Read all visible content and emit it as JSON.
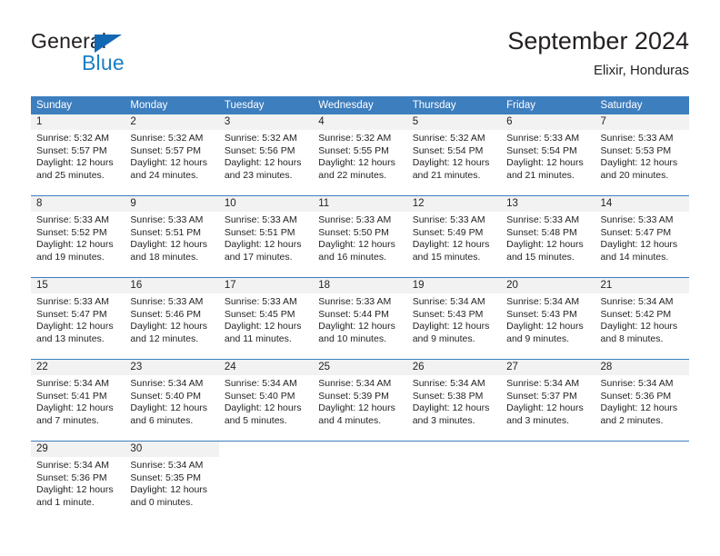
{
  "brand": {
    "name_part1": "General",
    "name_part2": "Blue",
    "triangle_icon": "triangle-icon",
    "color_dark": "#231f20",
    "color_blue": "#1b7fc4"
  },
  "header": {
    "title": "September 2024",
    "subtitle": "Elixir, Honduras"
  },
  "calendar": {
    "accent_color": "#3d7ebf",
    "daynum_band_color": "#f2f2f2",
    "weekday_headers": [
      "Sunday",
      "Monday",
      "Tuesday",
      "Wednesday",
      "Thursday",
      "Friday",
      "Saturday"
    ],
    "weeks": [
      [
        {
          "day": "1",
          "sunrise": "Sunrise: 5:32 AM",
          "sunset": "Sunset: 5:57 PM",
          "daylight_line1": "Daylight: 12 hours",
          "daylight_line2": "and 25 minutes."
        },
        {
          "day": "2",
          "sunrise": "Sunrise: 5:32 AM",
          "sunset": "Sunset: 5:57 PM",
          "daylight_line1": "Daylight: 12 hours",
          "daylight_line2": "and 24 minutes."
        },
        {
          "day": "3",
          "sunrise": "Sunrise: 5:32 AM",
          "sunset": "Sunset: 5:56 PM",
          "daylight_line1": "Daylight: 12 hours",
          "daylight_line2": "and 23 minutes."
        },
        {
          "day": "4",
          "sunrise": "Sunrise: 5:32 AM",
          "sunset": "Sunset: 5:55 PM",
          "daylight_line1": "Daylight: 12 hours",
          "daylight_line2": "and 22 minutes."
        },
        {
          "day": "5",
          "sunrise": "Sunrise: 5:32 AM",
          "sunset": "Sunset: 5:54 PM",
          "daylight_line1": "Daylight: 12 hours",
          "daylight_line2": "and 21 minutes."
        },
        {
          "day": "6",
          "sunrise": "Sunrise: 5:33 AM",
          "sunset": "Sunset: 5:54 PM",
          "daylight_line1": "Daylight: 12 hours",
          "daylight_line2": "and 21 minutes."
        },
        {
          "day": "7",
          "sunrise": "Sunrise: 5:33 AM",
          "sunset": "Sunset: 5:53 PM",
          "daylight_line1": "Daylight: 12 hours",
          "daylight_line2": "and 20 minutes."
        }
      ],
      [
        {
          "day": "8",
          "sunrise": "Sunrise: 5:33 AM",
          "sunset": "Sunset: 5:52 PM",
          "daylight_line1": "Daylight: 12 hours",
          "daylight_line2": "and 19 minutes."
        },
        {
          "day": "9",
          "sunrise": "Sunrise: 5:33 AM",
          "sunset": "Sunset: 5:51 PM",
          "daylight_line1": "Daylight: 12 hours",
          "daylight_line2": "and 18 minutes."
        },
        {
          "day": "10",
          "sunrise": "Sunrise: 5:33 AM",
          "sunset": "Sunset: 5:51 PM",
          "daylight_line1": "Daylight: 12 hours",
          "daylight_line2": "and 17 minutes."
        },
        {
          "day": "11",
          "sunrise": "Sunrise: 5:33 AM",
          "sunset": "Sunset: 5:50 PM",
          "daylight_line1": "Daylight: 12 hours",
          "daylight_line2": "and 16 minutes."
        },
        {
          "day": "12",
          "sunrise": "Sunrise: 5:33 AM",
          "sunset": "Sunset: 5:49 PM",
          "daylight_line1": "Daylight: 12 hours",
          "daylight_line2": "and 15 minutes."
        },
        {
          "day": "13",
          "sunrise": "Sunrise: 5:33 AM",
          "sunset": "Sunset: 5:48 PM",
          "daylight_line1": "Daylight: 12 hours",
          "daylight_line2": "and 15 minutes."
        },
        {
          "day": "14",
          "sunrise": "Sunrise: 5:33 AM",
          "sunset": "Sunset: 5:47 PM",
          "daylight_line1": "Daylight: 12 hours",
          "daylight_line2": "and 14 minutes."
        }
      ],
      [
        {
          "day": "15",
          "sunrise": "Sunrise: 5:33 AM",
          "sunset": "Sunset: 5:47 PM",
          "daylight_line1": "Daylight: 12 hours",
          "daylight_line2": "and 13 minutes."
        },
        {
          "day": "16",
          "sunrise": "Sunrise: 5:33 AM",
          "sunset": "Sunset: 5:46 PM",
          "daylight_line1": "Daylight: 12 hours",
          "daylight_line2": "and 12 minutes."
        },
        {
          "day": "17",
          "sunrise": "Sunrise: 5:33 AM",
          "sunset": "Sunset: 5:45 PM",
          "daylight_line1": "Daylight: 12 hours",
          "daylight_line2": "and 11 minutes."
        },
        {
          "day": "18",
          "sunrise": "Sunrise: 5:33 AM",
          "sunset": "Sunset: 5:44 PM",
          "daylight_line1": "Daylight: 12 hours",
          "daylight_line2": "and 10 minutes."
        },
        {
          "day": "19",
          "sunrise": "Sunrise: 5:34 AM",
          "sunset": "Sunset: 5:43 PM",
          "daylight_line1": "Daylight: 12 hours",
          "daylight_line2": "and 9 minutes."
        },
        {
          "day": "20",
          "sunrise": "Sunrise: 5:34 AM",
          "sunset": "Sunset: 5:43 PM",
          "daylight_line1": "Daylight: 12 hours",
          "daylight_line2": "and 9 minutes."
        },
        {
          "day": "21",
          "sunrise": "Sunrise: 5:34 AM",
          "sunset": "Sunset: 5:42 PM",
          "daylight_line1": "Daylight: 12 hours",
          "daylight_line2": "and 8 minutes."
        }
      ],
      [
        {
          "day": "22",
          "sunrise": "Sunrise: 5:34 AM",
          "sunset": "Sunset: 5:41 PM",
          "daylight_line1": "Daylight: 12 hours",
          "daylight_line2": "and 7 minutes."
        },
        {
          "day": "23",
          "sunrise": "Sunrise: 5:34 AM",
          "sunset": "Sunset: 5:40 PM",
          "daylight_line1": "Daylight: 12 hours",
          "daylight_line2": "and 6 minutes."
        },
        {
          "day": "24",
          "sunrise": "Sunrise: 5:34 AM",
          "sunset": "Sunset: 5:40 PM",
          "daylight_line1": "Daylight: 12 hours",
          "daylight_line2": "and 5 minutes."
        },
        {
          "day": "25",
          "sunrise": "Sunrise: 5:34 AM",
          "sunset": "Sunset: 5:39 PM",
          "daylight_line1": "Daylight: 12 hours",
          "daylight_line2": "and 4 minutes."
        },
        {
          "day": "26",
          "sunrise": "Sunrise: 5:34 AM",
          "sunset": "Sunset: 5:38 PM",
          "daylight_line1": "Daylight: 12 hours",
          "daylight_line2": "and 3 minutes."
        },
        {
          "day": "27",
          "sunrise": "Sunrise: 5:34 AM",
          "sunset": "Sunset: 5:37 PM",
          "daylight_line1": "Daylight: 12 hours",
          "daylight_line2": "and 3 minutes."
        },
        {
          "day": "28",
          "sunrise": "Sunrise: 5:34 AM",
          "sunset": "Sunset: 5:36 PM",
          "daylight_line1": "Daylight: 12 hours",
          "daylight_line2": "and 2 minutes."
        }
      ],
      [
        {
          "day": "29",
          "sunrise": "Sunrise: 5:34 AM",
          "sunset": "Sunset: 5:36 PM",
          "daylight_line1": "Daylight: 12 hours",
          "daylight_line2": "and 1 minute."
        },
        {
          "day": "30",
          "sunrise": "Sunrise: 5:34 AM",
          "sunset": "Sunset: 5:35 PM",
          "daylight_line1": "Daylight: 12 hours",
          "daylight_line2": "and 0 minutes."
        },
        {
          "day": "",
          "sunrise": "",
          "sunset": "",
          "daylight_line1": "",
          "daylight_line2": ""
        },
        {
          "day": "",
          "sunrise": "",
          "sunset": "",
          "daylight_line1": "",
          "daylight_line2": ""
        },
        {
          "day": "",
          "sunrise": "",
          "sunset": "",
          "daylight_line1": "",
          "daylight_line2": ""
        },
        {
          "day": "",
          "sunrise": "",
          "sunset": "",
          "daylight_line1": "",
          "daylight_line2": ""
        },
        {
          "day": "",
          "sunrise": "",
          "sunset": "",
          "daylight_line1": "",
          "daylight_line2": ""
        }
      ]
    ]
  }
}
